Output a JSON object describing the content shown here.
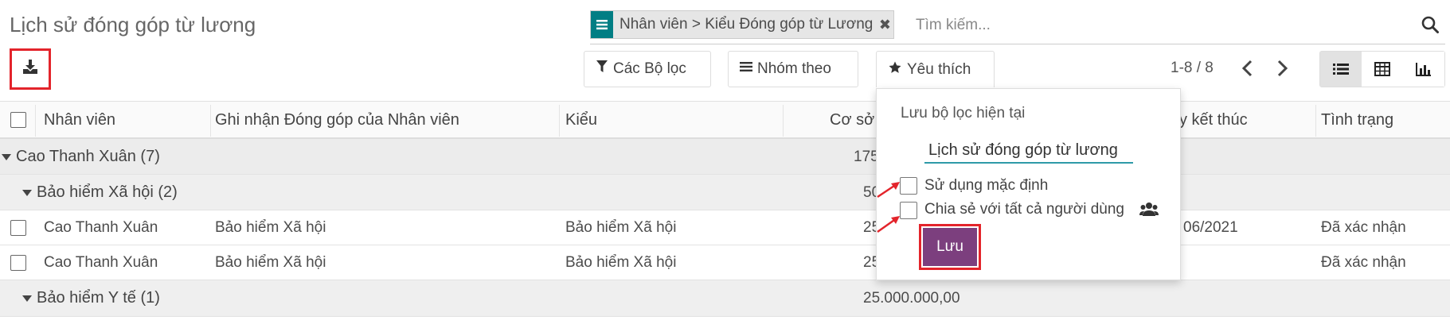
{
  "page": {
    "title": "Lịch sử đóng góp từ lương"
  },
  "search": {
    "facet": "Nhân viên > Kiểu Đóng góp từ Lương",
    "placeholder": "Tìm kiếm..."
  },
  "toolbar": {
    "filters_label": "Các Bộ lọc",
    "group_by_label": "Nhóm theo",
    "favorites_label": "Yêu thích",
    "pager": "1-8 / 8"
  },
  "table": {
    "headers": {
      "employee": "Nhân viên",
      "record": "Ghi nhận Đóng góp của Nhân viên",
      "type": "Kiểu",
      "base": "Cơ sở",
      "end_date": "y kết thúc",
      "status": "Tình trạng"
    },
    "groups": {
      "g1_label": "Cao Thanh Xuân (7)",
      "g1_value": "175",
      "g2_label": "Bảo hiểm Xã hội (2)",
      "g2_value": "50",
      "g3_label": "Bảo hiểm Y tế (1)",
      "g3_value": "25.000.000,00"
    },
    "rows": [
      {
        "employee": "Cao Thanh Xuân",
        "record": "Bảo hiểm Xã hội",
        "type": "Bảo hiểm Xã hội",
        "base": "25",
        "end_date": "06/2021",
        "status": "Đã xác nhận"
      },
      {
        "employee": "Cao Thanh Xuân",
        "record": "Bảo hiểm Xã hội",
        "type": "Bảo hiểm Xã hội",
        "base": "25",
        "end_date": "",
        "status": "Đã xác nhận"
      }
    ]
  },
  "favorites_dropdown": {
    "title": "Lưu bộ lọc hiện tại",
    "filter_name": "Lịch sử đóng góp từ lương",
    "use_default_label": "Sử dụng mặc định",
    "share_all_label": "Chia sẻ với tất cả người dùng",
    "save_label": "Lưu"
  },
  "colors": {
    "accent_teal": "#017e84",
    "save_purple": "#7c3f7e",
    "highlight_red": "#e3242b"
  }
}
